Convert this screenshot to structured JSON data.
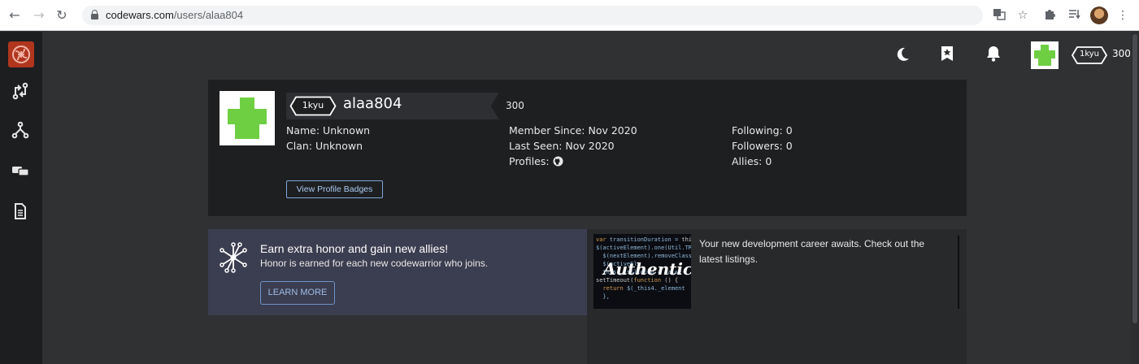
{
  "browser": {
    "url_host": "codewars.com",
    "url_path": "/users/alaa804"
  },
  "header": {
    "rank": "1kyu",
    "honor": "300"
  },
  "profile": {
    "rank": "1kyu",
    "username": "alaa804",
    "honor": "300",
    "name": "Name: Unknown",
    "clan": "Clan: Unknown",
    "member_since": "Member Since: Nov 2020",
    "last_seen": "Last Seen: Nov 2020",
    "profiles_label": "Profiles:",
    "following": "Following: 0",
    "followers": "Followers: 0",
    "allies": "Allies: 0",
    "badges_button": "View Profile Badges"
  },
  "promo": {
    "title": "Earn extra honor and gain new allies!",
    "subtitle": "Honor is earned for each new codewarrior who joins.",
    "button": "LEARN MORE"
  },
  "ad": {
    "text": "Your new development career awaits. Check out the latest listings.",
    "image_caption": "Authentic"
  },
  "icons": {
    "rail": [
      "codewars-logo",
      "pull-request-icon",
      "fork-icon",
      "chat-icon",
      "document-icon"
    ],
    "header": [
      "moon-icon",
      "bookmark-star-icon",
      "bell-icon"
    ]
  },
  "colors": {
    "accent_red": "#b1361e",
    "avatar_green": "#6fcf43",
    "link_blue": "#7fa8d8"
  }
}
